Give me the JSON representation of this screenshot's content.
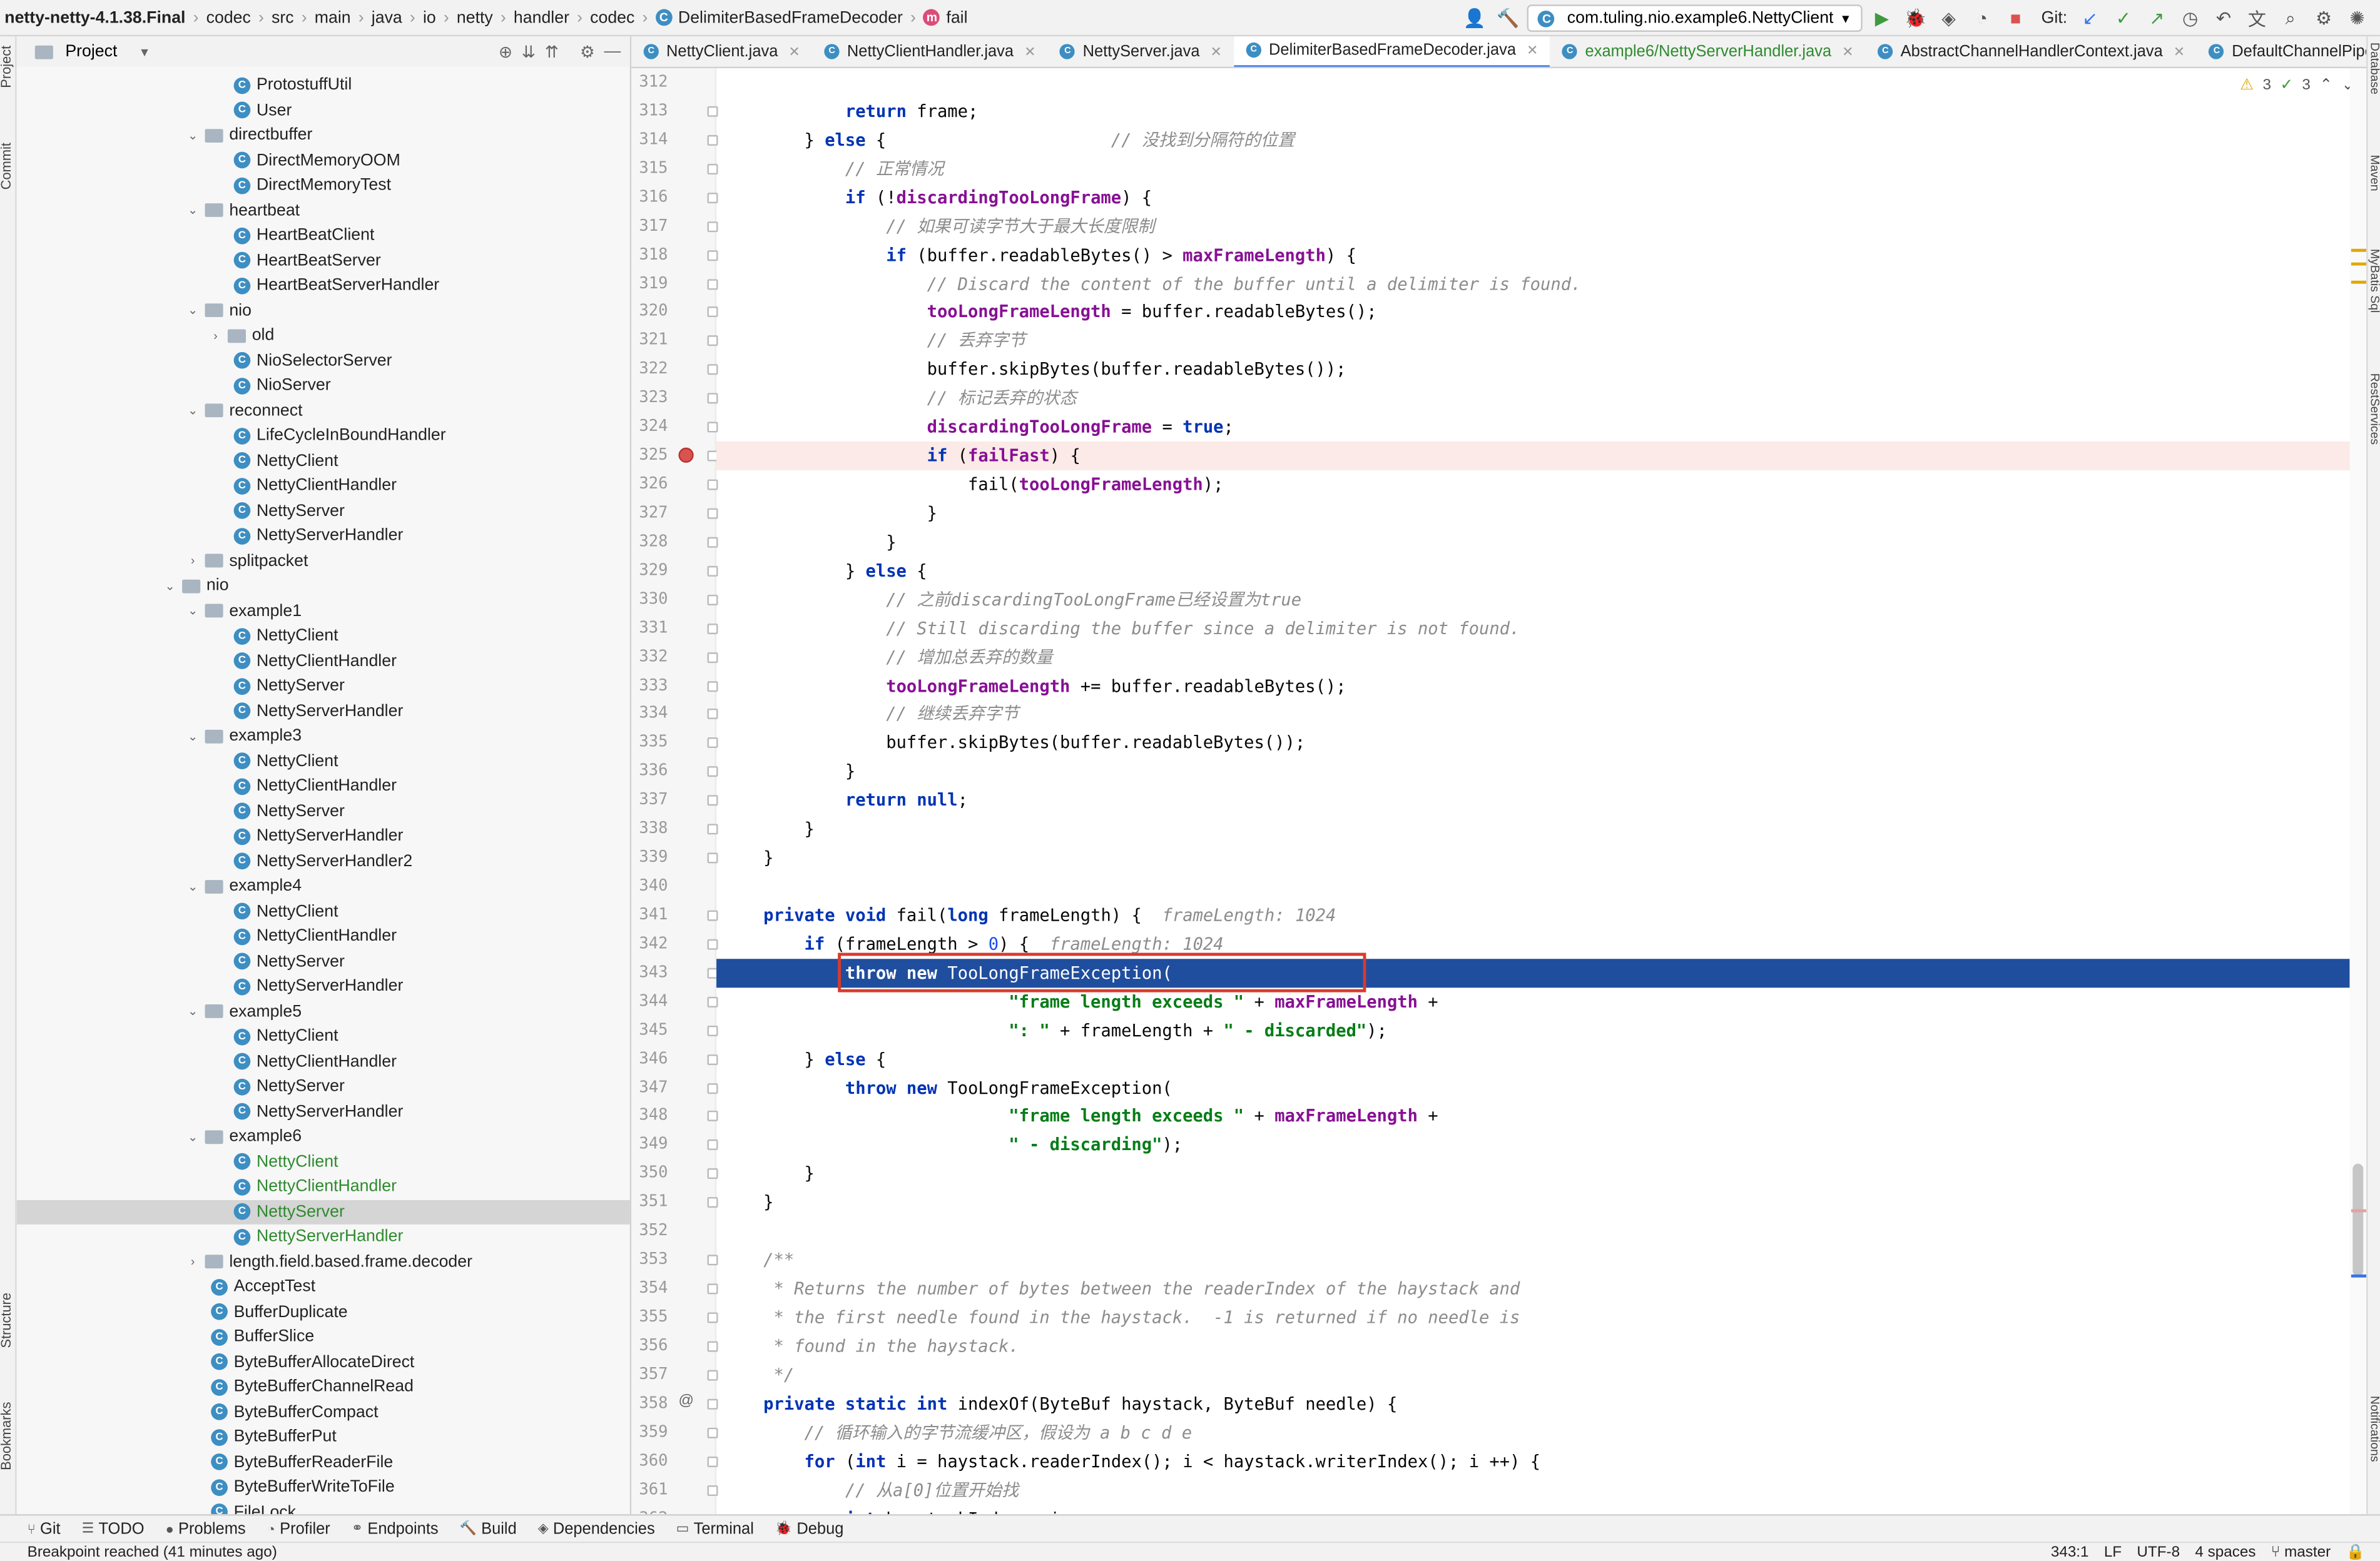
{
  "navbar": {
    "breadcrumbs": [
      "netty-netty-4.1.38.Final",
      "codec",
      "src",
      "main",
      "java",
      "io",
      "netty",
      "handler",
      "codec",
      "DelimiterBasedFrameDecoder",
      "fail"
    ],
    "run_config": "com.tuling.nio.example6.NettyClient",
    "git_label": "Git:"
  },
  "left_strip": {
    "project": "Project",
    "commit": "Commit",
    "structure": "Structure",
    "bookmarks": "Bookmarks"
  },
  "right_strip": {
    "database": "Database",
    "maven": "Maven",
    "mybatis": "MyBatis Sql",
    "restservices": "RestServices",
    "notifications": "Notifications"
  },
  "project_panel": {
    "title": "Project",
    "tree": [
      {
        "label": "ProtostuffUtil",
        "type": "class",
        "indent": 3
      },
      {
        "label": "User",
        "type": "class",
        "indent": 3
      },
      {
        "label": "directbuffer",
        "type": "folder",
        "indent": 2,
        "expanded": true
      },
      {
        "label": "DirectMemoryOOM",
        "type": "class",
        "indent": 3
      },
      {
        "label": "DirectMemoryTest",
        "type": "class",
        "indent": 3
      },
      {
        "label": "heartbeat",
        "type": "folder",
        "indent": 2,
        "expanded": true
      },
      {
        "label": "HeartBeatClient",
        "type": "class",
        "indent": 3
      },
      {
        "label": "HeartBeatServer",
        "type": "class",
        "indent": 3
      },
      {
        "label": "HeartBeatServerHandler",
        "type": "class",
        "indent": 3
      },
      {
        "label": "nio",
        "type": "folder",
        "indent": 2,
        "expanded": true
      },
      {
        "label": "old",
        "type": "folder",
        "indent": 3,
        "expanded": false
      },
      {
        "label": "NioSelectorServer",
        "type": "class",
        "indent": 3
      },
      {
        "label": "NioServer",
        "type": "class",
        "indent": 3
      },
      {
        "label": "reconnect",
        "type": "folder",
        "indent": 2,
        "expanded": true
      },
      {
        "label": "LifeCycleInBoundHandler",
        "type": "class",
        "indent": 3
      },
      {
        "label": "NettyClient",
        "type": "class",
        "indent": 3
      },
      {
        "label": "NettyClientHandler",
        "type": "class",
        "indent": 3
      },
      {
        "label": "NettyServer",
        "type": "class",
        "indent": 3
      },
      {
        "label": "NettyServerHandler",
        "type": "class",
        "indent": 3
      },
      {
        "label": "splitpacket",
        "type": "folder",
        "indent": 2,
        "expanded": false
      },
      {
        "label": "nio",
        "type": "folder",
        "indent": 1,
        "expanded": true
      },
      {
        "label": "example1",
        "type": "folder",
        "indent": 2,
        "expanded": true
      },
      {
        "label": "NettyClient",
        "type": "class",
        "indent": 3
      },
      {
        "label": "NettyClientHandler",
        "type": "class",
        "indent": 3
      },
      {
        "label": "NettyServer",
        "type": "class",
        "indent": 3
      },
      {
        "label": "NettyServerHandler",
        "type": "class",
        "indent": 3
      },
      {
        "label": "example3",
        "type": "folder",
        "indent": 2,
        "expanded": true
      },
      {
        "label": "NettyClient",
        "type": "class",
        "indent": 3
      },
      {
        "label": "NettyClientHandler",
        "type": "class",
        "indent": 3
      },
      {
        "label": "NettyServer",
        "type": "class",
        "indent": 3
      },
      {
        "label": "NettyServerHandler",
        "type": "class",
        "indent": 3
      },
      {
        "label": "NettyServerHandler2",
        "type": "class",
        "indent": 3
      },
      {
        "label": "example4",
        "type": "folder",
        "indent": 2,
        "expanded": true
      },
      {
        "label": "NettyClient",
        "type": "class",
        "indent": 3
      },
      {
        "label": "NettyClientHandler",
        "type": "class",
        "indent": 3
      },
      {
        "label": "NettyServer",
        "type": "class",
        "indent": 3
      },
      {
        "label": "NettyServerHandler",
        "type": "class",
        "indent": 3
      },
      {
        "label": "example5",
        "type": "folder",
        "indent": 2,
        "expanded": true
      },
      {
        "label": "NettyClient",
        "type": "class",
        "indent": 3
      },
      {
        "label": "NettyClientHandler",
        "type": "class",
        "indent": 3
      },
      {
        "label": "NettyServer",
        "type": "class",
        "indent": 3
      },
      {
        "label": "NettyServerHandler",
        "type": "class",
        "indent": 3
      },
      {
        "label": "example6",
        "type": "folder",
        "indent": 2,
        "expanded": true
      },
      {
        "label": "NettyClient",
        "type": "class",
        "indent": 3,
        "green": true
      },
      {
        "label": "NettyClientHandler",
        "type": "class",
        "indent": 3,
        "green": true
      },
      {
        "label": "NettyServer",
        "type": "class",
        "indent": 3,
        "green": true,
        "selected": true
      },
      {
        "label": "NettyServerHandler",
        "type": "class",
        "indent": 3,
        "green": true
      },
      {
        "label": "length.field.based.frame.decoder",
        "type": "folder",
        "indent": 2,
        "expanded": false
      },
      {
        "label": "AcceptTest",
        "type": "class",
        "indent": 2
      },
      {
        "label": "BufferDuplicate",
        "type": "class",
        "indent": 2
      },
      {
        "label": "BufferSlice",
        "type": "class",
        "indent": 2
      },
      {
        "label": "ByteBufferAllocateDirect",
        "type": "class",
        "indent": 2
      },
      {
        "label": "ByteBufferChannelRead",
        "type": "class",
        "indent": 2
      },
      {
        "label": "ByteBufferCompact",
        "type": "class",
        "indent": 2
      },
      {
        "label": "ByteBufferPut",
        "type": "class",
        "indent": 2
      },
      {
        "label": "ByteBufferReaderFile",
        "type": "class",
        "indent": 2
      },
      {
        "label": "ByteBufferWriteToFile",
        "type": "class",
        "indent": 2
      },
      {
        "label": "FileLock",
        "type": "class",
        "indent": 2
      }
    ]
  },
  "tabs": [
    {
      "label": "NettyClient.java",
      "active": false
    },
    {
      "label": "NettyClientHandler.java",
      "active": false
    },
    {
      "label": "NettyServer.java",
      "active": false
    },
    {
      "label": "DelimiterBasedFrameDecoder.java",
      "active": true
    },
    {
      "label": "example6/NettyServerHandler.java",
      "active": false
    },
    {
      "label": "AbstractChannelHandlerContext.java",
      "active": false
    },
    {
      "label": "DefaultChannelPipeline.java",
      "active": false
    }
  ],
  "inspections": {
    "warnings": "3",
    "ok": "3"
  },
  "editor": {
    "lines": [
      {
        "n": "312",
        "html": ""
      },
      {
        "n": "313",
        "html": "            <span class='kw'>return</span> frame;"
      },
      {
        "n": "314",
        "html": "        } <span class='kw'>else</span> {                      <span class='cmt'>// 没找到分隔符的位置</span>"
      },
      {
        "n": "315",
        "html": "            <span class='cmt'>// 正常情况</span>"
      },
      {
        "n": "316",
        "html": "            <span class='kw'>if</span> (!<span class='fld'>discardingTooLongFrame</span>) {"
      },
      {
        "n": "317",
        "html": "                <span class='cmt'>// 如果可读字节大于最大长度限制</span>"
      },
      {
        "n": "318",
        "html": "                <span class='kw'>if</span> (buffer.readableBytes() &gt; <span class='fld'>maxFrameLength</span>) {"
      },
      {
        "n": "319",
        "html": "                    <span class='cmt'>// Discard the content of the buffer until a delimiter is found.</span>"
      },
      {
        "n": "320",
        "html": "                    <span class='fld'>tooLongFrameLength</span> = buffer.readableBytes();"
      },
      {
        "n": "321",
        "html": "                    <span class='cmt'>// 丢弃字节</span>"
      },
      {
        "n": "322",
        "html": "                    buffer.skipBytes(buffer.readableBytes());"
      },
      {
        "n": "323",
        "html": "                    <span class='cmt'>// 标记丢弃的状态</span>"
      },
      {
        "n": "324",
        "html": "                    <span class='fld'>discardingTooLongFrame</span> = <span class='kw'>true</span>;"
      },
      {
        "n": "325",
        "html": "                    <span class='kw'>if</span> (<span class='fld'>failFast</span>) {",
        "bp": true
      },
      {
        "n": "326",
        "html": "                        fail(<span class='fld'>tooLongFrameLength</span>);"
      },
      {
        "n": "327",
        "html": "                    }"
      },
      {
        "n": "328",
        "html": "                }"
      },
      {
        "n": "329",
        "html": "            } <span class='kw'>else</span> {"
      },
      {
        "n": "330",
        "html": "                <span class='cmt'>// 之前discardingTooLongFrame已经设置为true</span>"
      },
      {
        "n": "331",
        "html": "                <span class='cmt'>// Still discarding the buffer since a delimiter is not found.</span>"
      },
      {
        "n": "332",
        "html": "                <span class='cmt'>// 增加总丢弃的数量</span>"
      },
      {
        "n": "333",
        "html": "                <span class='fld'>tooLongFrameLength</span> += buffer.readableBytes();"
      },
      {
        "n": "334",
        "html": "                <span class='cmt'>// 继续丢弃字节</span>"
      },
      {
        "n": "335",
        "html": "                buffer.skipBytes(buffer.readableBytes());"
      },
      {
        "n": "336",
        "html": "            }"
      },
      {
        "n": "337",
        "html": "            <span class='kw'>return null</span>;"
      },
      {
        "n": "338",
        "html": "        }"
      },
      {
        "n": "339",
        "html": "    }"
      },
      {
        "n": "340",
        "html": ""
      },
      {
        "n": "341",
        "html": "    <span class='kw'>private void</span> fail(<span class='kw'>long</span> frameLength) {  <span class='hint'>frameLength: 1024</span>"
      },
      {
        "n": "342",
        "html": "        <span class='kw'>if</span> (frameLength &gt; <span class='num'>0</span>) {  <span class='hint'>frameLength: 1024</span>"
      },
      {
        "n": "343",
        "html": "            <span class='kw'>throw new</span> TooLongFrameException(",
        "hl": true
      },
      {
        "n": "344",
        "html": "                            <span class='str'>\"frame length exceeds \"</span> + <span class='fld'>maxFrameLength</span> +"
      },
      {
        "n": "345",
        "html": "                            <span class='str'>\": \"</span> + frameLength + <span class='str'>\" - discarded\"</span>);"
      },
      {
        "n": "346",
        "html": "        } <span class='kw'>else</span> {"
      },
      {
        "n": "347",
        "html": "            <span class='kw'>throw new</span> TooLongFrameException("
      },
      {
        "n": "348",
        "html": "                            <span class='str'>\"frame length exceeds \"</span> + <span class='fld'>maxFrameLength</span> +"
      },
      {
        "n": "349",
        "html": "                            <span class='str'>\" - discarding\"</span>);"
      },
      {
        "n": "350",
        "html": "        }"
      },
      {
        "n": "351",
        "html": "    }"
      },
      {
        "n": "352",
        "html": ""
      },
      {
        "n": "353",
        "html": "    <span class='cmt'>/**</span>"
      },
      {
        "n": "354",
        "html": "    <span class='cmt'> * Returns the number of bytes between the readerIndex of the haystack and</span>"
      },
      {
        "n": "355",
        "html": "    <span class='cmt'> * the first needle found in the haystack.  -1 is returned if no needle is</span>"
      },
      {
        "n": "356",
        "html": "    <span class='cmt'> * found in the haystack.</span>"
      },
      {
        "n": "357",
        "html": "    <span class='cmt'> */</span>"
      },
      {
        "n": "358",
        "html": "    <span class='kw'>private static int</span> indexOf(ByteBuf haystack, ByteBuf needle) {",
        "at": true
      },
      {
        "n": "359",
        "html": "        <span class='cmt'>// 循环输入的字节流缓冲区，假设为 a b c d e</span>"
      },
      {
        "n": "360",
        "html": "        <span class='kw'>for</span> (<span class='kw'>int</span> i = haystack.readerIndex(); i &lt; haystack.writerIndex(); i ++) {"
      },
      {
        "n": "361",
        "html": "            <span class='cmt'>// 从a[0]位置开始找</span>"
      },
      {
        "n": "362",
        "html": "            <span class='kw'>int</span> haystackIndex = i;"
      }
    ]
  },
  "bottom_tools": [
    {
      "label": "Git",
      "icon": "git-icon"
    },
    {
      "label": "TODO",
      "icon": "todo-icon"
    },
    {
      "label": "Problems",
      "icon": "problems-icon"
    },
    {
      "label": "Profiler",
      "icon": "profiler-icon"
    },
    {
      "label": "Endpoints",
      "icon": "endpoints-icon"
    },
    {
      "label": "Build",
      "icon": "build-icon"
    },
    {
      "label": "Dependencies",
      "icon": "dependencies-icon"
    },
    {
      "label": "Terminal",
      "icon": "terminal-icon"
    },
    {
      "label": "Debug",
      "icon": "debug-icon"
    }
  ],
  "status": {
    "message": "Breakpoint reached (41 minutes ago)",
    "position": "343:1",
    "line_ending": "LF",
    "encoding": "UTF-8",
    "indent": "4 spaces",
    "branch": "master"
  }
}
